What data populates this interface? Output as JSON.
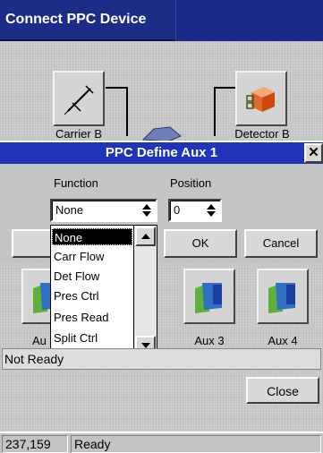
{
  "window": {
    "title": "Connect PPC Device"
  },
  "devices": {
    "carrier_b": "Carrier B",
    "detector_b": "Detector B",
    "aux_partial": "Au",
    "aux_3": "Aux 3",
    "aux_4": "Aux 4"
  },
  "dialog": {
    "title": "PPC Define Aux 1",
    "close_glyph": "✕",
    "function_label": "Function",
    "position_label": "Position",
    "function_value": "None",
    "position_value": "0",
    "ok_label": "OK",
    "cancel_label": "Cancel",
    "dropdown_options": [
      "None",
      "Carr Flow",
      "Det Flow",
      "Pres Ctrl",
      "Pres Read",
      "Split Ctrl"
    ],
    "selected_option": "None"
  },
  "status": {
    "text": "Not Ready"
  },
  "footer": {
    "close_label": "Close"
  },
  "taskbar": {
    "coords": "237,159",
    "state": "Ready"
  },
  "colors": {
    "title_bar": "#1d2d87",
    "dialog_title_bar": "#1f34b8"
  }
}
